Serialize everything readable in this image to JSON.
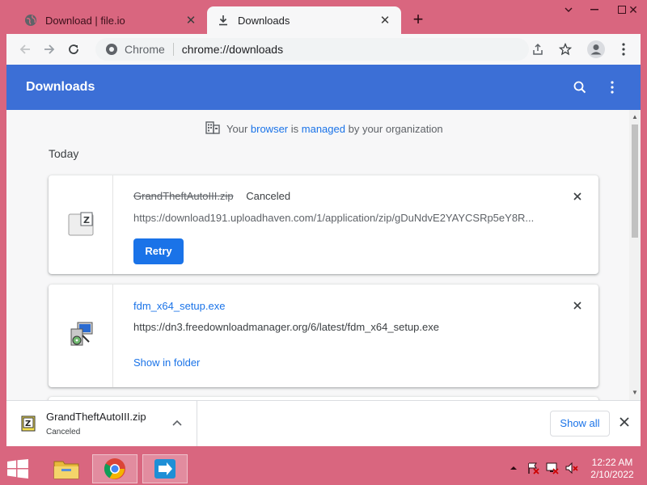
{
  "browser": {
    "tabs": [
      {
        "title": "Download | file.io",
        "icon": "globe-icon",
        "active": false
      },
      {
        "title": "Downloads",
        "icon": "download-icon",
        "active": true
      }
    ],
    "omnibox": {
      "chip": "Chrome",
      "url": "chrome://downloads"
    }
  },
  "header": {
    "title": "Downloads"
  },
  "managed_notice": {
    "prefix": "Your ",
    "link1": "browser",
    "middle": " is ",
    "link2": "managed",
    "suffix": " by your organization"
  },
  "section": {
    "label": "Today"
  },
  "downloads": [
    {
      "file_name": "GrandTheftAutoIII.zip",
      "status": "Canceled",
      "url": "https://download191.uploadhaven.com/1/application/zip/gDuNdvE2YAYCSRp5eY8R...",
      "action_label": "Retry",
      "icon": "zip-file-icon"
    },
    {
      "file_name": "fdm_x64_setup.exe",
      "status": "",
      "url": "https://dn3.freedownloadmanager.org/6/latest/fdm_x64_setup.exe",
      "action_label": "Show in folder",
      "icon": "installer-icon"
    }
  ],
  "shelf": {
    "item": {
      "file_name": "GrandTheftAutoIII.zip",
      "status": "Canceled"
    },
    "show_all_label": "Show all"
  },
  "taskbar": {
    "apps": [
      "file-explorer-icon",
      "chrome-icon",
      "free-download-manager-icon"
    ],
    "clock": {
      "time": "12:22 AM",
      "date": "2/10/2022"
    }
  },
  "colors": {
    "accent": "#3c6fd6",
    "link": "#1a73e8",
    "frame": "#d9667f"
  }
}
